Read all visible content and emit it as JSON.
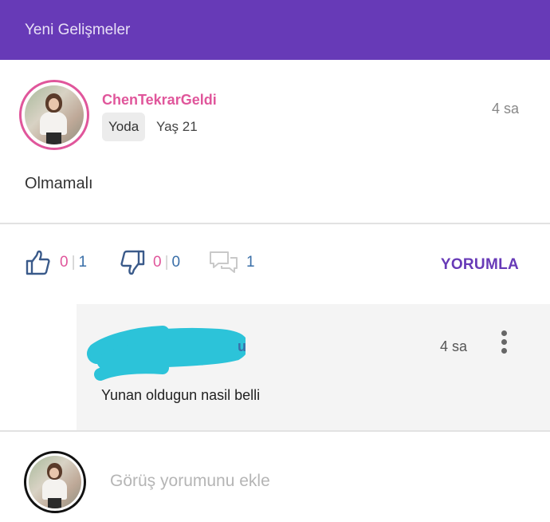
{
  "topbar": {
    "title": "Yeni Gelişmeler",
    "color": "#673ab7"
  },
  "post": {
    "avatar_icon": "user-avatar-photo",
    "username": "ChenTekrarGeldi",
    "badge": "Yoda",
    "age": "Yaş 21",
    "time": "4 sa",
    "text": "Olmamalı"
  },
  "actions": {
    "like": {
      "icon": "thumbs-up-icon",
      "count_a": "0",
      "count_b": "1"
    },
    "dislike": {
      "icon": "thumbs-down-icon",
      "count_a": "0",
      "count_b": "0"
    },
    "comments": {
      "icon": "comment-bubbles-icon",
      "count": "1"
    },
    "comment_button": "YORUMLA"
  },
  "reply": {
    "author_visible_fragment": "u",
    "time": "4 sa",
    "text": "Yunan oldugun nasil belli",
    "menu_icon": "more-vertical-icon"
  },
  "composer": {
    "placeholder": "Görüş yorumunu ekle",
    "value": ""
  },
  "colors": {
    "accent": "#673ab7",
    "pink": "#e0569b",
    "blue": "#3a6fa8",
    "redaction": "#2cc3d9"
  }
}
